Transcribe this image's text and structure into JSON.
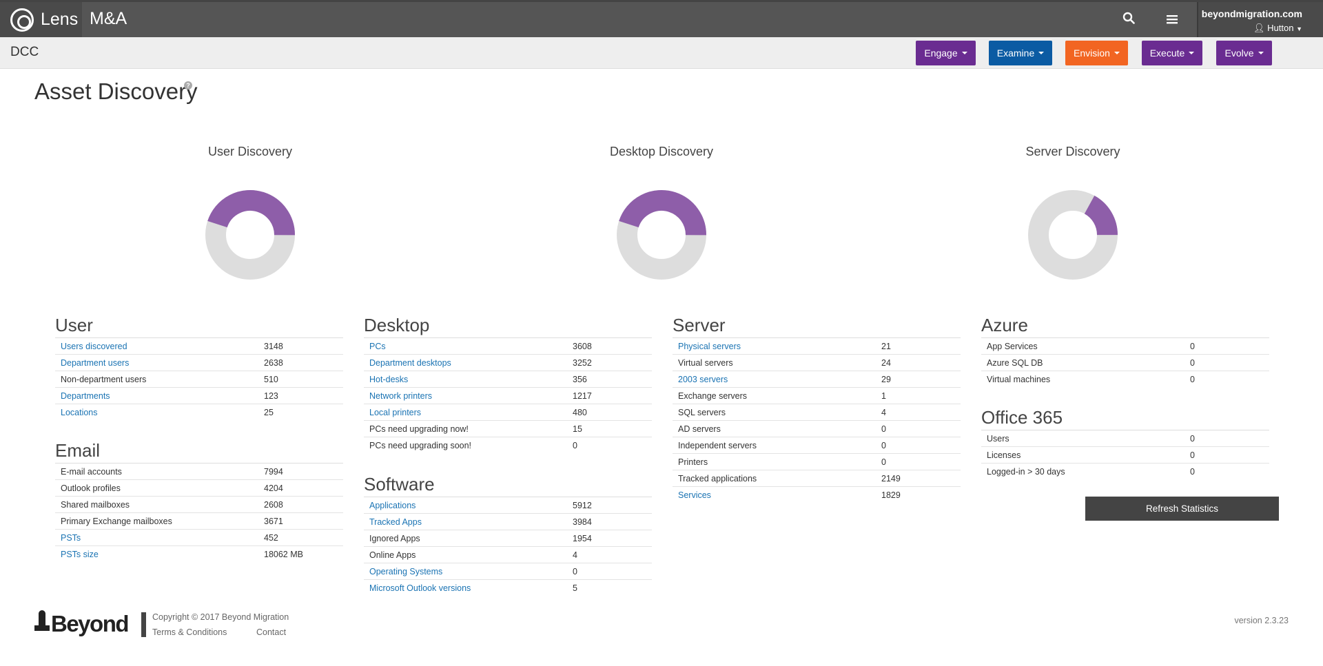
{
  "header": {
    "brand": "Lens",
    "app_name": "M&A",
    "account_domain": "beyondmigration.com",
    "account_user": "Hutton"
  },
  "subnav": {
    "org": "DCC",
    "menus": [
      {
        "label": "Engage",
        "color": "#6a2c91"
      },
      {
        "label": "Examine",
        "color": "#0b5ba3"
      },
      {
        "label": "Envision",
        "color": "#f26522"
      },
      {
        "label": "Execute",
        "color": "#6a2c91"
      },
      {
        "label": "Evolve",
        "color": "#6a2c91"
      }
    ]
  },
  "page": {
    "title": "Asset Discovery",
    "help": "?"
  },
  "donuts": [
    {
      "title": "User Discovery",
      "fraction": 0.45
    },
    {
      "title": "Desktop Discovery",
      "fraction": 0.45
    },
    {
      "title": "Server Discovery",
      "fraction": 0.17
    }
  ],
  "colors": {
    "donut_fill": "#8e5ea9",
    "donut_track": "#dddddd",
    "link": "#1a73b3"
  },
  "panels": {
    "user": {
      "heading": "User",
      "rows": [
        {
          "label": "Users discovered",
          "value": "3148",
          "link": true
        },
        {
          "label": "Department users",
          "value": "2638",
          "link": true
        },
        {
          "label": "Non-department users",
          "value": "510",
          "link": false
        },
        {
          "label": "Departments",
          "value": "123",
          "link": true
        },
        {
          "label": "Locations",
          "value": "25",
          "link": true
        }
      ]
    },
    "email": {
      "heading": "Email",
      "rows": [
        {
          "label": "E-mail accounts",
          "value": "7994",
          "link": false
        },
        {
          "label": "Outlook profiles",
          "value": "4204",
          "link": false
        },
        {
          "label": "Shared mailboxes",
          "value": "2608",
          "link": false
        },
        {
          "label": "Primary Exchange mailboxes",
          "value": "3671",
          "link": false
        },
        {
          "label": "PSTs",
          "value": "452",
          "link": true
        },
        {
          "label": "PSTs size",
          "value": "18062 MB",
          "link": true
        }
      ]
    },
    "desktop": {
      "heading": "Desktop",
      "rows": [
        {
          "label": "PCs",
          "value": "3608",
          "link": true
        },
        {
          "label": "Department desktops",
          "value": "3252",
          "link": true
        },
        {
          "label": "Hot-desks",
          "value": "356",
          "link": true
        },
        {
          "label": "Network printers",
          "value": "1217",
          "link": true
        },
        {
          "label": "Local printers",
          "value": "480",
          "link": true
        },
        {
          "label": "PCs need upgrading now!",
          "value": "15",
          "link": false
        },
        {
          "label": "PCs need upgrading soon!",
          "value": "0",
          "link": false
        }
      ]
    },
    "software": {
      "heading": "Software",
      "rows": [
        {
          "label": "Applications",
          "value": "5912",
          "link": true
        },
        {
          "label": "Tracked Apps",
          "value": "3984",
          "link": true
        },
        {
          "label": "Ignored Apps",
          "value": "1954",
          "link": false
        },
        {
          "label": "Online Apps",
          "value": "4",
          "link": false
        },
        {
          "label": "Operating Systems",
          "value": "0",
          "link": true
        },
        {
          "label": "Microsoft Outlook versions",
          "value": "5",
          "link": true
        }
      ]
    },
    "server": {
      "heading": "Server",
      "rows": [
        {
          "label": "Physical servers",
          "value": "21",
          "link": true
        },
        {
          "label": "Virtual servers",
          "value": "24",
          "link": false
        },
        {
          "label": "2003 servers",
          "value": "29",
          "link": true
        },
        {
          "label": "Exchange servers",
          "value": "1",
          "link": false
        },
        {
          "label": "SQL servers",
          "value": "4",
          "link": false
        },
        {
          "label": "AD servers",
          "value": "0",
          "link": false
        },
        {
          "label": "Independent servers",
          "value": "0",
          "link": false
        },
        {
          "label": "Printers",
          "value": "0",
          "link": false
        },
        {
          "label": "Tracked applications",
          "value": "2149",
          "link": false
        },
        {
          "label": "Services",
          "value": "1829",
          "link": true
        }
      ]
    },
    "azure": {
      "heading": "Azure",
      "rows": [
        {
          "label": "App Services",
          "value": "0",
          "link": false
        },
        {
          "label": "Azure SQL DB",
          "value": "0",
          "link": false
        },
        {
          "label": "Virtual machines",
          "value": "0",
          "link": false
        }
      ]
    },
    "office365": {
      "heading": "Office 365",
      "rows": [
        {
          "label": "Users",
          "value": "0",
          "link": false
        },
        {
          "label": "Licenses",
          "value": "0",
          "link": false
        },
        {
          "label": "Logged-in > 30 days",
          "value": "0",
          "link": false
        }
      ]
    }
  },
  "refresh_label": "Refresh Statistics",
  "footer": {
    "logo_text": "Beyond",
    "copyright": "Copyright © 2017 Beyond Migration",
    "terms": "Terms & Conditions",
    "contact": "Contact",
    "version": "version 2.3.23"
  }
}
